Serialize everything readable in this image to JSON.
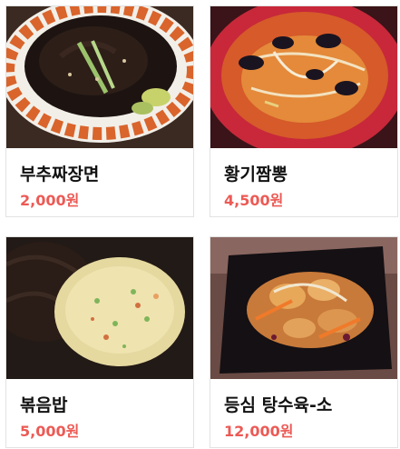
{
  "menu": {
    "items": [
      {
        "name": "부추짜장면",
        "price": "2,000원"
      },
      {
        "name": "황기짬뽕",
        "price": "4,500원"
      },
      {
        "name": "볶음밥",
        "price": "5,000원"
      },
      {
        "name": "등심 탕수육-소",
        "price": "12,000원"
      }
    ]
  },
  "colors": {
    "price": "#ec5a55",
    "name": "#111111",
    "border": "#e2e2e2"
  }
}
